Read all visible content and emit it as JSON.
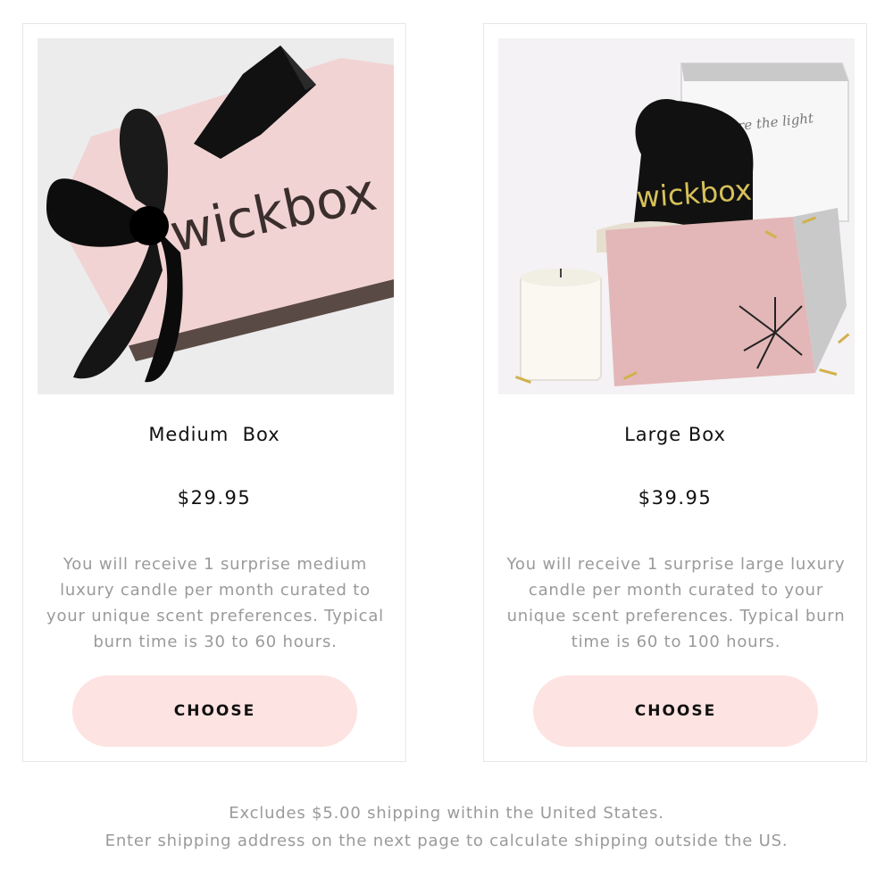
{
  "plans": [
    {
      "image_alt": "pink wickbox gift box with black ribbon",
      "box_wordmark": "wickbox",
      "title": "Medium  Box",
      "price": "$29.95",
      "description": "You will receive 1 surprise medium luxury candle per month curated to your unique scent preferences. Typical burn time is 30 to 60 hours.",
      "button_label": "CHOOSE"
    },
    {
      "image_alt": "open wickbox with candle and black pouch",
      "box_wordmark": "wickbox",
      "lid_text": "share the light",
      "title": "Large Box",
      "price": "$39.95",
      "description": "You will receive 1 surprise large luxury candle per month curated to your unique scent preferences. Typical burn time is 60 to 100 hours.",
      "button_label": "CHOOSE"
    }
  ],
  "footer": {
    "line1": "Excludes $5.00 shipping within the United States.",
    "line2": "Enter shipping address on the next page to calculate shipping outside the US."
  },
  "colors": {
    "button_bg": "#fde3e1",
    "muted_text": "#9a9a9a",
    "box_pink": "#f2d3d3"
  }
}
